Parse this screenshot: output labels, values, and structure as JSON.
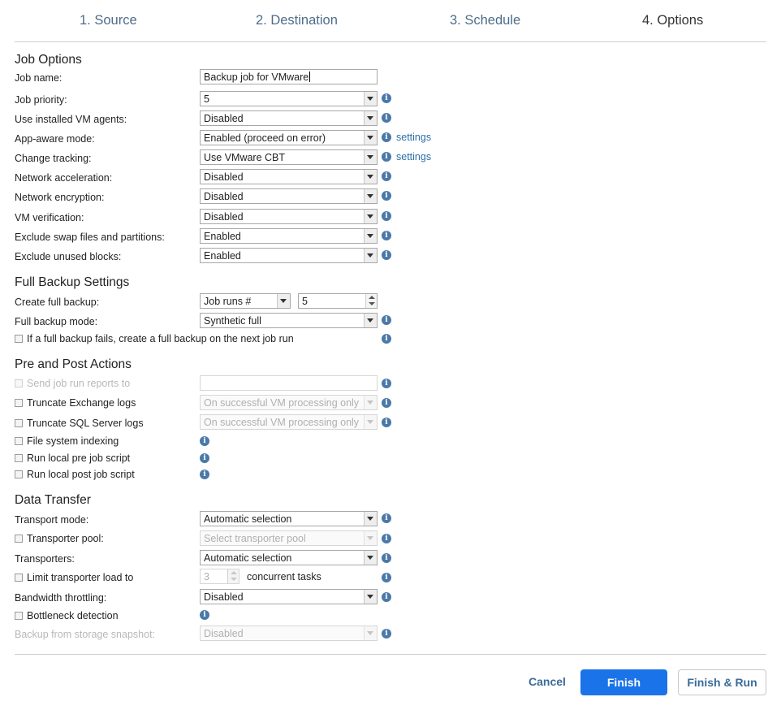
{
  "steps": [
    "1. Source",
    "2. Destination",
    "3. Schedule",
    "4. Options"
  ],
  "job_options": {
    "title": "Job Options",
    "job_name_label": "Job name:",
    "job_name_value": "Backup job for VMware",
    "rows": [
      {
        "label": "Job priority:",
        "value": "5"
      },
      {
        "label": "Use installed VM agents:",
        "value": "Disabled"
      },
      {
        "label": "App-aware mode:",
        "value": "Enabled (proceed on error)",
        "link": "settings"
      },
      {
        "label": "Change tracking:",
        "value": "Use VMware CBT",
        "link": "settings"
      },
      {
        "label": "Network acceleration:",
        "value": "Disabled"
      },
      {
        "label": "Network encryption:",
        "value": "Disabled"
      },
      {
        "label": "VM verification:",
        "value": "Disabled"
      },
      {
        "label": "Exclude swap files and partitions:",
        "value": "Enabled"
      },
      {
        "label": "Exclude unused blocks:",
        "value": "Enabled"
      }
    ]
  },
  "full_backup": {
    "title": "Full Backup Settings",
    "create_label": "Create full backup:",
    "create_mode": "Job runs #",
    "create_count": "5",
    "mode_label": "Full backup mode:",
    "mode_value": "Synthetic full",
    "fail_label": "If a full backup fails, create a full backup on the next job run"
  },
  "pre_post": {
    "title": "Pre and Post Actions",
    "send_reports_label": "Send job run reports to",
    "send_reports_value": "",
    "truncate_exchange_label": "Truncate Exchange logs",
    "truncate_exchange_value": "On successful VM processing only",
    "truncate_sql_label": "Truncate SQL Server logs",
    "truncate_sql_value": "On successful VM processing only",
    "fs_indexing_label": "File system indexing",
    "pre_script_label": "Run local pre job script",
    "post_script_label": "Run local post job script"
  },
  "data_transfer": {
    "title": "Data Transfer",
    "transport_mode_label": "Transport mode:",
    "transport_mode_value": "Automatic selection",
    "transporter_pool_label": "Transporter pool:",
    "transporter_pool_value": "Select transporter pool",
    "transporters_label": "Transporters:",
    "transporters_value": "Automatic selection",
    "limit_label": "Limit transporter load to",
    "limit_value": "3",
    "limit_suffix": "concurrent tasks",
    "bandwidth_label": "Bandwidth throttling:",
    "bandwidth_value": "Disabled",
    "bottleneck_label": "Bottleneck detection",
    "snapshot_label": "Backup from storage snapshot:",
    "snapshot_value": "Disabled"
  },
  "footer": {
    "cancel": "Cancel",
    "finish": "Finish",
    "finish_run": "Finish & Run"
  },
  "info_glyph": "i",
  "colors": {
    "primary": "#1a73e8",
    "link": "#2e6fa8",
    "info": "#4a78a8"
  }
}
